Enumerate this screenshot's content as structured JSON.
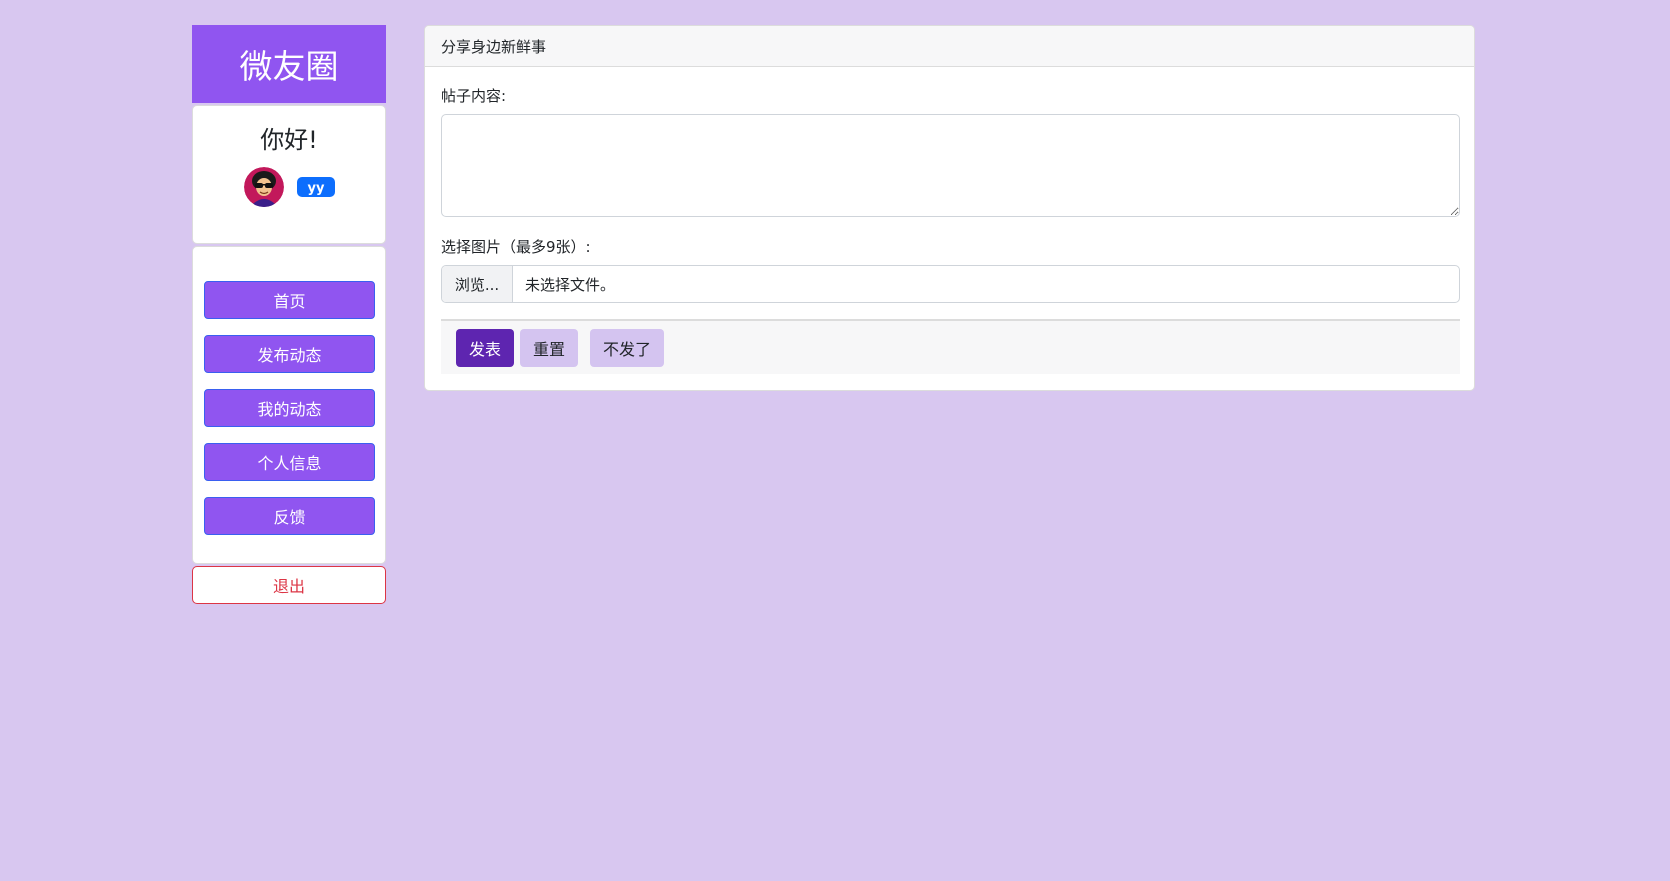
{
  "sidebar": {
    "brand": "微友圈",
    "greeting": "你好!",
    "username": "yy",
    "nav": [
      "首页",
      "发布动态",
      "我的动态",
      "个人信息",
      "反馈"
    ],
    "logout": "退出"
  },
  "post_form": {
    "header": "分享身边新鲜事",
    "content_label": "帖子内容:",
    "content_value": "",
    "image_label": "选择图片（最多9张）:",
    "browse_label": "浏览...",
    "file_status": "未选择文件。",
    "buttons": {
      "publish": "发表",
      "reset": "重置",
      "cancel": "不发了"
    }
  },
  "colors": {
    "background": "#d8c7f0",
    "primary_purple": "#9055f0",
    "publish_button": "#5e25b0",
    "secondary_button": "#d4c4f0",
    "username_badge": "#0d6efd",
    "logout": "#dc3545"
  },
  "icons": {
    "avatar": "user-avatar-sunglasses"
  }
}
